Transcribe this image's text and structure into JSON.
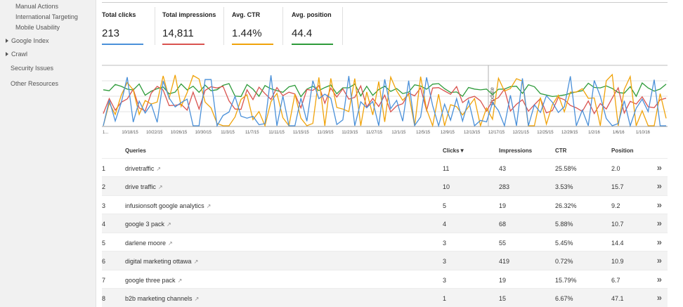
{
  "sidebar": {
    "sub_items": [
      "Manual Actions",
      "International Targeting",
      "Mobile Usability"
    ],
    "expandables": [
      "Google Index",
      "Crawl"
    ],
    "plain_items": [
      "Security Issues",
      "Other Resources"
    ]
  },
  "metrics": [
    {
      "label": "Total clicks",
      "value": "213",
      "color": "#4a90d9"
    },
    {
      "label": "Total impressions",
      "value": "14,811",
      "color": "#d9534f"
    },
    {
      "label": "Avg. CTR",
      "value": "1.44%",
      "color": "#f0a30a"
    },
    {
      "label": "Avg. position",
      "value": "44.4",
      "color": "#2e9b3a"
    }
  ],
  "chart": {
    "x_labels": [
      "10/18/15",
      "10/22/15",
      "10/26/15",
      "10/30/15",
      "11/3/15",
      "11/7/15",
      "11/11/15",
      "11/15/15",
      "11/19/15",
      "11/23/15",
      "11/27/15",
      "12/1/15",
      "12/5/15",
      "12/9/15",
      "12/13/15",
      "12/17/15",
      "12/21/15",
      "12/25/15",
      "12/29/15",
      "1/2/16",
      "1/6/16",
      "1/10/16"
    ],
    "start_tick": "1...",
    "annotation": "Update"
  },
  "table": {
    "headers": {
      "queries": "Queries",
      "clicks": "Clicks▼",
      "impressions": "Impressions",
      "ctr": "CTR",
      "position": "Position"
    },
    "rows": [
      {
        "n": "1",
        "query": "drivetraffic",
        "clicks": "11",
        "impressions": "43",
        "ctr": "25.58%",
        "position": "2.0"
      },
      {
        "n": "2",
        "query": "drive traffic",
        "clicks": "10",
        "impressions": "283",
        "ctr": "3.53%",
        "position": "15.7"
      },
      {
        "n": "3",
        "query": "infusionsoft google analytics",
        "clicks": "5",
        "impressions": "19",
        "ctr": "26.32%",
        "position": "9.2"
      },
      {
        "n": "4",
        "query": "google 3 pack",
        "clicks": "4",
        "impressions": "68",
        "ctr": "5.88%",
        "position": "10.7"
      },
      {
        "n": "5",
        "query": "darlene moore",
        "clicks": "3",
        "impressions": "55",
        "ctr": "5.45%",
        "position": "14.4"
      },
      {
        "n": "6",
        "query": "digital marketing ottawa",
        "clicks": "3",
        "impressions": "419",
        "ctr": "0.72%",
        "position": "10.9"
      },
      {
        "n": "7",
        "query": "google three pack",
        "clicks": "3",
        "impressions": "19",
        "ctr": "15.79%",
        "position": "6.7"
      },
      {
        "n": "8",
        "query": "b2b marketing channels",
        "clicks": "1",
        "impressions": "15",
        "ctr": "6.67%",
        "position": "47.1"
      }
    ],
    "row_action_glyph": "»",
    "external_link_glyph": "↗"
  }
}
